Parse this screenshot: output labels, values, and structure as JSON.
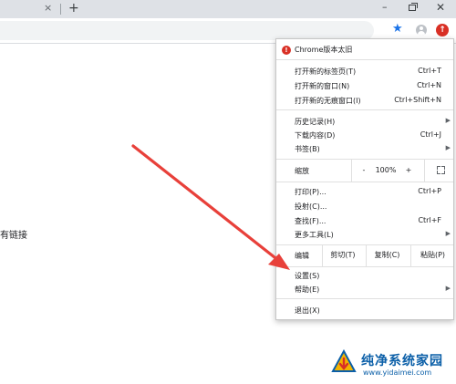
{
  "window": {
    "close_tab_glyph": "×",
    "new_tab_glyph": "+",
    "minimize_glyph": "–",
    "close_glyph": "✕"
  },
  "toolbar": {
    "bookmark_icon": "star-icon",
    "profile_icon": "profile-icon",
    "update_icon": "update-icon",
    "update_glyph": "↑"
  },
  "page": {
    "partial_text": "有链接"
  },
  "menu": {
    "update_notice": "Chrome版本太旧",
    "new_tab": {
      "label": "打开新的标签页(T)",
      "shortcut": "Ctrl+T"
    },
    "new_window": {
      "label": "打开新的窗口(N)",
      "shortcut": "Ctrl+N"
    },
    "incognito": {
      "label": "打开新的无痕窗口(I)",
      "shortcut": "Ctrl+Shift+N"
    },
    "history": {
      "label": "历史记录(H)"
    },
    "downloads": {
      "label": "下载内容(D)",
      "shortcut": "Ctrl+J"
    },
    "bookmarks": {
      "label": "书签(B)"
    },
    "zoom": {
      "label": "缩放",
      "minus": "-",
      "value": "100%",
      "plus": "+"
    },
    "print": {
      "label": "打印(P)...",
      "shortcut": "Ctrl+P"
    },
    "cast": {
      "label": "投射(C)..."
    },
    "find": {
      "label": "查找(F)...",
      "shortcut": "Ctrl+F"
    },
    "more_tools": {
      "label": "更多工具(L)"
    },
    "edit": {
      "label": "编辑",
      "cut": "剪切(T)",
      "copy": "复制(C)",
      "paste": "粘贴(P)"
    },
    "settings": {
      "label": "设置(S)"
    },
    "help": {
      "label": "帮助(E)"
    },
    "exit": {
      "label": "退出(X)"
    }
  },
  "watermark": {
    "name_cn": "纯净系统家园",
    "url": "www.yidaimei.com"
  },
  "colors": {
    "accent_red": "#d93025",
    "annotation_arrow": "#e8403a",
    "star_blue": "#1a73e8",
    "watermark_blue": "#0b5fa8"
  }
}
